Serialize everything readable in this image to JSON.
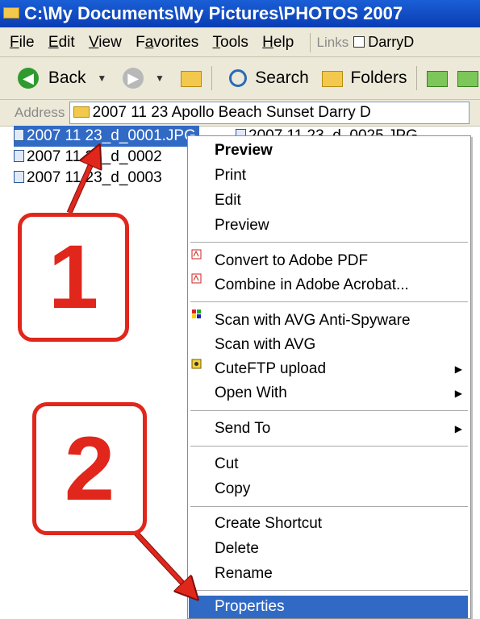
{
  "window": {
    "title": "C:\\My Documents\\My Pictures\\PHOTOS 2007"
  },
  "menu": {
    "items": [
      "File",
      "Edit",
      "View",
      "Favorites",
      "Tools",
      "Help"
    ],
    "links_label": "Links",
    "links_item": "DarryD"
  },
  "toolbar": {
    "back_label": "Back",
    "search_label": "Search",
    "folders_label": "Folders"
  },
  "address": {
    "label": "Address",
    "value": "2007 11 23 Apollo Beach Sunset Darry D"
  },
  "files": [
    "2007 11 23_d_0001.JPG",
    "2007 11 23_d_0002",
    "2007 11 23_d_0003",
    "2007 11 23_d_0025.JPG"
  ],
  "context_menu": {
    "items": [
      "Preview",
      "Print",
      "Edit",
      "Preview",
      "Convert to Adobe PDF",
      "Combine in Adobe Acrobat...",
      "Scan with AVG Anti-Spyware",
      "Scan with AVG",
      "CuteFTP upload",
      "Open With",
      "Send To",
      "Cut",
      "Copy",
      "Create Shortcut",
      "Delete",
      "Rename",
      "Properties"
    ]
  },
  "callouts": {
    "step1": "1",
    "step2": "2"
  },
  "colors": {
    "callout_red": "#e1261c",
    "highlight_blue": "#316ac5",
    "titlebar_blue": "#0a3db3"
  }
}
